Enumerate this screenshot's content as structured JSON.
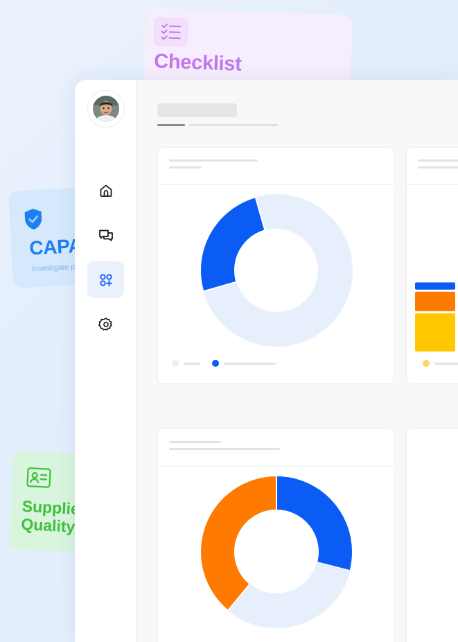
{
  "feature_cards": {
    "checklist": {
      "title": "Checklist",
      "icon": "checklist-icon",
      "color": "#c178ee"
    },
    "capa": {
      "title": "CAPA",
      "subtitle": "Investigate p",
      "icon": "shield-check-icon",
      "color": "#1d7ff0"
    },
    "supplier_quality": {
      "title": "Supplier\nQuality",
      "icon": "id-card-icon",
      "color": "#3fbf3a"
    }
  },
  "sidebar": {
    "avatar": "user-avatar",
    "items": [
      {
        "name": "home",
        "icon": "home-icon",
        "active": false
      },
      {
        "name": "messages",
        "icon": "chat-icon",
        "active": false
      },
      {
        "name": "apps",
        "icon": "apps-icon",
        "active": true
      },
      {
        "name": "settings",
        "icon": "gear-icon",
        "active": false
      }
    ]
  },
  "colors": {
    "blue": "#0a5cf5",
    "orange": "#ff7a00",
    "yellow": "#ffc700",
    "track": "#e7effc"
  },
  "chart_data": [
    {
      "type": "pie",
      "style": "donut",
      "slices": [
        {
          "value": 75,
          "color": "#e7effc"
        },
        {
          "value": 25,
          "color": "#0a5cf5"
        }
      ]
    },
    {
      "type": "bar",
      "stacked": true,
      "segments": [
        {
          "value": 53,
          "color": "#ffc700"
        },
        {
          "value": 27,
          "color": "#ff7a00"
        },
        {
          "value": 10,
          "color": "#0a5cf5"
        }
      ]
    },
    {
      "type": "pie",
      "style": "donut",
      "slices": [
        {
          "value": 29,
          "color": "#0a5cf5"
        },
        {
          "value": 32,
          "color": "#e7effc"
        },
        {
          "value": 39,
          "color": "#ff7a00"
        }
      ]
    }
  ]
}
